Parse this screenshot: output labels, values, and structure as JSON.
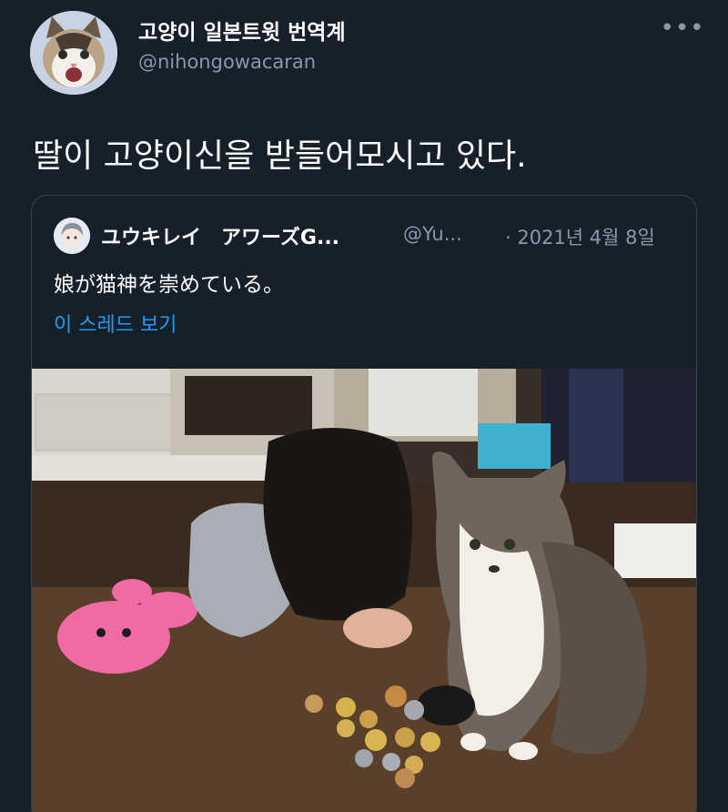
{
  "tweet": {
    "display_name": "고양이 일본트윗 번역계",
    "handle": "@nihongowacaran",
    "more_label": "•••",
    "text": "딸이 고양이신을 받들어모시고 있다.",
    "avatar_icon": "cat-avatar-icon"
  },
  "quoted": {
    "display_name": "ユウキレイ　アワーズG...",
    "handle": "@Yu...",
    "date": "· 2021년 4월 8일",
    "text": "娘が猫神を崇めている。",
    "thread_link": "이 스레드 보기",
    "avatar_icon": "user-avatar-icon",
    "photo_icon": "girl-praying-to-cat-photo"
  },
  "colors": {
    "background": "#15202b",
    "secondary_text": "#8b98a5",
    "link": "#1d9bf0",
    "border": "#38444d"
  }
}
